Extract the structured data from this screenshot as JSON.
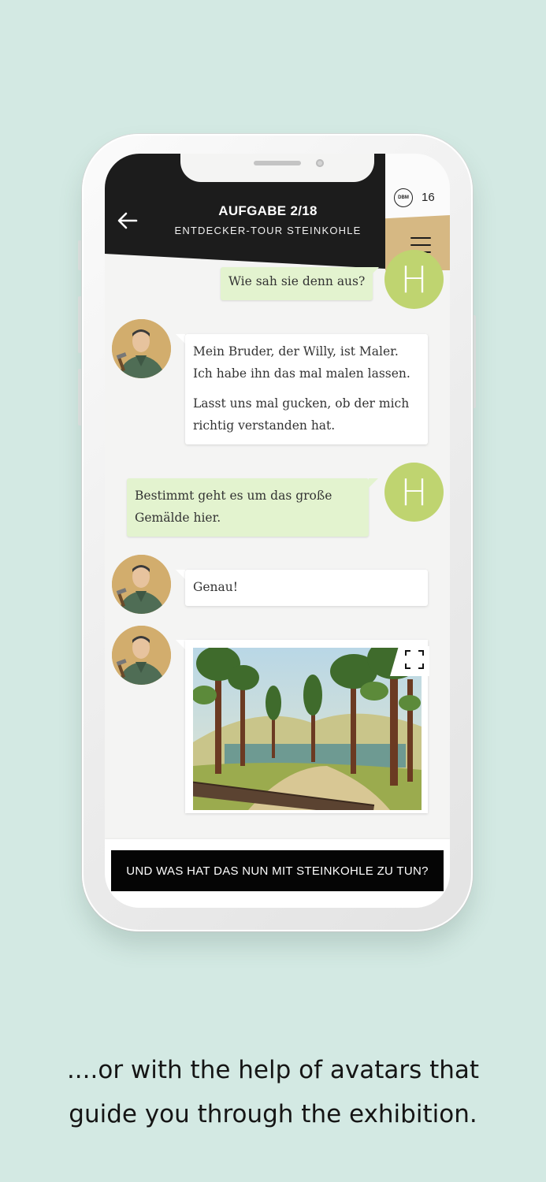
{
  "header": {
    "title": "AUFGABE 2/18",
    "subtitle": "ENTDECKER-TOUR STEINKOHLE",
    "back_icon": "arrow-left-icon",
    "badge_label": "DBM",
    "score": "16",
    "menu_icon": "hamburger-menu-icon"
  },
  "chat": {
    "messages": [
      {
        "sender": "user",
        "avatar_letter": "H",
        "lines": [
          "Wie sah sie denn aus?"
        ]
      },
      {
        "sender": "guide",
        "paragraphs": [
          [
            "Mein Bruder, der Willy, ist Maler.",
            "Ich habe ihn das mal malen lassen."
          ],
          [
            "Lasst uns mal gucken, ob der mich",
            "richtig verstanden hat."
          ]
        ]
      },
      {
        "sender": "user",
        "avatar_letter": "H",
        "lines": [
          "Bestimmt geht es um das große",
          "Gemälde hier."
        ]
      },
      {
        "sender": "guide",
        "lines": [
          "Genau!"
        ]
      },
      {
        "sender": "guide",
        "type": "image",
        "image_icon": "forest-painting",
        "expand_icon": "fullscreen-icon"
      }
    ]
  },
  "action_button": "UND WAS HAT DAS NUN MIT STEINKOHLE ZU TUN?",
  "caption": {
    "line1": "....or with the help of avatars that",
    "line2": "guide you through the exhibition."
  },
  "colors": {
    "background": "#d3e9e3",
    "header": "#1c1c1c",
    "menu_accent": "#d6b883",
    "user_bubble": "#e3f3cf",
    "user_avatar": "#bfd470"
  }
}
